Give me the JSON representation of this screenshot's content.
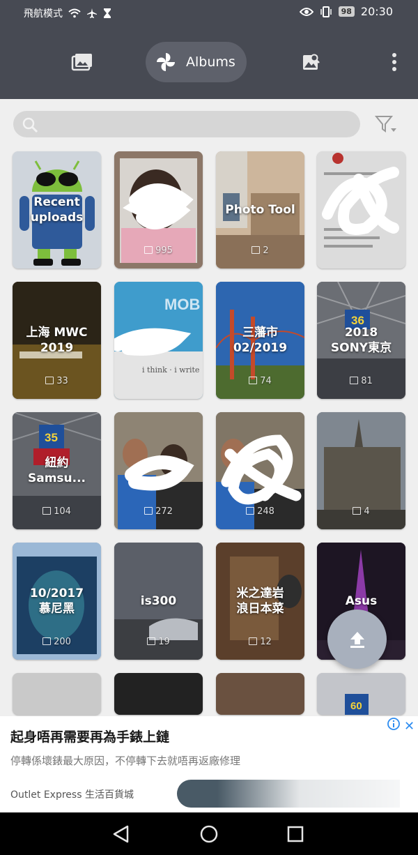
{
  "status_bar": {
    "left_text": "飛航模式",
    "icons_left": [
      "wifi-icon",
      "airplane-icon",
      "hourglass-icon"
    ],
    "icons_right": [
      "eye-icon",
      "vibrate-icon"
    ],
    "battery": "98",
    "time": "20:30"
  },
  "toolbar": {
    "albums_label": "Albums",
    "icons": [
      "photos-icon",
      "pinwheel-icon",
      "search-photo-icon",
      "more-vert-icon"
    ]
  },
  "search": {
    "placeholder": ""
  },
  "albums": [
    {
      "title": "Recent\nuploads",
      "count": ""
    },
    {
      "title": "",
      "count": "995"
    },
    {
      "title": "Photo Tool",
      "count": "2"
    },
    {
      "title": "",
      "count": ""
    },
    {
      "title": "上海 MWC\n2019",
      "count": "33"
    },
    {
      "title": "",
      "count": ""
    },
    {
      "title": "三藩市\n02/2019",
      "count": "74"
    },
    {
      "title": "2018\nSONY東京",
      "count": "81"
    },
    {
      "title": "紐約\nSamsu...",
      "count": "104"
    },
    {
      "title": "",
      "count": "272"
    },
    {
      "title": "",
      "count": "248"
    },
    {
      "title": "",
      "count": "4"
    },
    {
      "title": "10/2017\n慕尼黑",
      "count": "200"
    },
    {
      "title": "is300",
      "count": "19"
    },
    {
      "title": "米之達岩\n浪日本菜",
      "count": "12"
    },
    {
      "title": "Asus",
      "count": ""
    }
  ],
  "ad": {
    "title": "起身唔再需要再為手錶上鏈",
    "subtitle": "停轉係壞錶最大原因，不停轉下去就唔再返廠修理",
    "source": "Outlet Express 生活百貨城",
    "close": "✕"
  },
  "colors": {
    "toolbar_bg": "#474a53",
    "pill_bg": "#5e616b",
    "fab_bg": "#a8b0bd",
    "page_bg": "#efefef"
  }
}
